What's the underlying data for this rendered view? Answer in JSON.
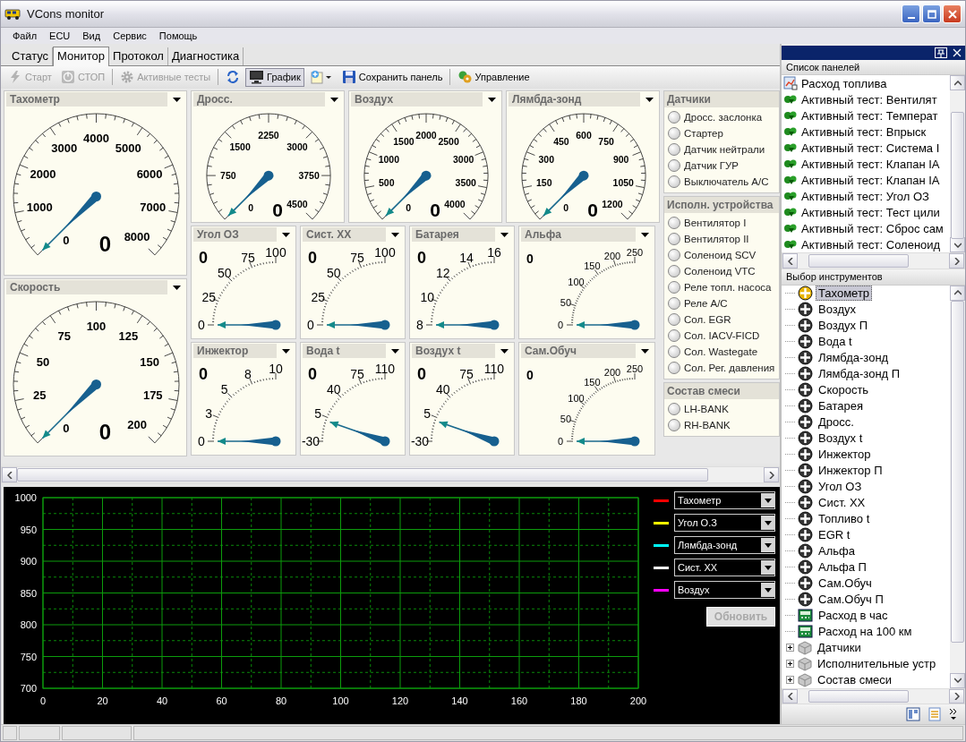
{
  "window": {
    "title": "VCons monitor"
  },
  "menu": [
    "Файл",
    "ECU",
    "Вид",
    "Сервис",
    "Помощь"
  ],
  "tabs": [
    {
      "label": "Статус",
      "selected": false
    },
    {
      "label": "Монитор",
      "selected": true
    },
    {
      "label": "Протокол",
      "selected": false
    },
    {
      "label": "Диагностика",
      "selected": false
    }
  ],
  "toolbar": [
    [
      {
        "kind": "start",
        "label": "Старт",
        "disabled": true,
        "pressed": false
      },
      {
        "kind": "stop",
        "label": "СТОП",
        "disabled": true,
        "pressed": false
      }
    ],
    [
      {
        "kind": "tests",
        "label": "Активные тесты",
        "disabled": true,
        "pressed": false
      }
    ],
    [
      {
        "kind": "refresh",
        "disabled": false,
        "pressed": false
      },
      {
        "kind": "graph",
        "label": "График",
        "disabled": false,
        "pressed": true
      },
      {
        "kind": "add_panel",
        "disabled": false,
        "pressed": false
      },
      {
        "kind": "save",
        "label": "Сохранить панель",
        "disabled": false,
        "pressed": false
      }
    ],
    [
      {
        "kind": "control",
        "label": "Управление",
        "disabled": false,
        "pressed": false
      }
    ]
  ],
  "dashboard": {
    "large": [
      {
        "kind": "round",
        "title": "Тахометр",
        "ticks": [
          "0",
          "1000",
          "2000",
          "3000",
          "4000",
          "5000",
          "6000",
          "7000",
          "8000"
        ],
        "value": "0"
      },
      {
        "kind": "round",
        "title": "Скорость",
        "ticks": [
          "0",
          "25",
          "50",
          "75",
          "100",
          "125",
          "150",
          "175",
          "200"
        ],
        "value": "0"
      }
    ],
    "medium": [
      {
        "kind": "round",
        "title": "Дросс.",
        "ticks": [
          "0",
          "750",
          "1500",
          "2250",
          "3000",
          "3750",
          "4500"
        ],
        "value": "0"
      },
      {
        "kind": "round",
        "title": "Воздух",
        "ticks": [
          "0",
          "500",
          "1000",
          "1500",
          "2000",
          "2500",
          "3000",
          "3500",
          "4000"
        ],
        "value": "0"
      },
      {
        "kind": "round",
        "title": "Лямбда-зонд",
        "ticks": [
          "0",
          "150",
          "300",
          "450",
          "600",
          "750",
          "900",
          "1050",
          "1200"
        ],
        "value": "0"
      }
    ],
    "small_rows": [
      [
        {
          "kind": "quarter",
          "title": "Угол ОЗ",
          "ticks": [
            "0",
            "25",
            "50",
            "75",
            "100"
          ],
          "value": "0"
        },
        {
          "kind": "quarter",
          "title": "Сист. XX",
          "ticks": [
            "0",
            "25",
            "50",
            "75",
            "100"
          ],
          "value": "0"
        },
        {
          "kind": "quarter",
          "title": "Батарея",
          "ticks": [
            "8",
            "10",
            "12",
            "14",
            "16"
          ],
          "value": "0"
        },
        {
          "kind": "quarter",
          "title": "Альфа",
          "ticks": [
            "0",
            "50",
            "100",
            "150",
            "200",
            "250"
          ],
          "value": "0"
        }
      ],
      [
        {
          "kind": "quarter",
          "title": "Инжектор",
          "ticks": [
            "0",
            "3",
            "5",
            "8",
            "10"
          ],
          "value": "0"
        },
        {
          "kind": "quarter",
          "title": "Вода t",
          "ticks": [
            "-30",
            "5",
            "40",
            "75",
            "110"
          ],
          "value": "0"
        },
        {
          "kind": "quarter",
          "title": "Воздух t",
          "ticks": [
            "-30",
            "5",
            "40",
            "75",
            "110"
          ],
          "value": "0"
        },
        {
          "kind": "quarter",
          "title": "Сам.Обуч",
          "ticks": [
            "0",
            "50",
            "100",
            "150",
            "200",
            "250"
          ],
          "value": "0"
        }
      ]
    ]
  },
  "indicator_groups": [
    {
      "title": "Датчики",
      "items": [
        {
          "label": "Дросс. заслонка",
          "on": false
        },
        {
          "label": "Стартер",
          "on": false
        },
        {
          "label": "Датчик нейтрали",
          "on": false
        },
        {
          "label": "Датчик ГУР",
          "on": false
        },
        {
          "label": "Выключатель A/C",
          "on": false
        }
      ]
    },
    {
      "title": "Исполн. устройства",
      "items": [
        {
          "label": "Вентилятор I",
          "on": false
        },
        {
          "label": "Вентилятор II",
          "on": false
        },
        {
          "label": "Соленоид SCV",
          "on": false
        },
        {
          "label": "Соленоид VTC",
          "on": false
        },
        {
          "label": "Реле топл. насоса",
          "on": false
        },
        {
          "label": "Реле A/C",
          "on": false
        },
        {
          "label": "Сол. EGR",
          "on": false
        },
        {
          "label": "Сол. IACV-FICD",
          "on": false
        },
        {
          "label": "Сол. Wastegate",
          "on": false
        },
        {
          "label": "Сол. Рег. давления",
          "on": false
        }
      ]
    },
    {
      "title": "Состав смеси",
      "items": [
        {
          "label": "LH-BANK",
          "on": false
        },
        {
          "label": "RH-BANK",
          "on": false
        }
      ]
    }
  ],
  "graph": {
    "chart_data": {
      "type": "line",
      "grid": true,
      "xlim": [
        0,
        200
      ],
      "ylim": [
        700,
        1000
      ],
      "xticks": [
        0,
        20,
        40,
        60,
        80,
        100,
        120,
        140,
        160,
        180,
        200
      ],
      "yticks": [
        700,
        750,
        800,
        850,
        900,
        950,
        1000
      ],
      "ref_lines": [
        {
          "axis": "x",
          "value": 10
        },
        {
          "axis": "x",
          "value": 30
        },
        {
          "axis": "x",
          "value": 50
        },
        {
          "axis": "x",
          "value": 70
        },
        {
          "axis": "x",
          "value": 90
        },
        {
          "axis": "x",
          "value": 110
        },
        {
          "axis": "x",
          "value": 130
        },
        {
          "axis": "x",
          "value": 150
        },
        {
          "axis": "x",
          "value": 170
        },
        {
          "axis": "x",
          "value": 190
        },
        {
          "axis": "y",
          "value": 725
        },
        {
          "axis": "y",
          "value": 775
        },
        {
          "axis": "y",
          "value": 825
        },
        {
          "axis": "y",
          "value": 875
        },
        {
          "axis": "y",
          "value": 925
        },
        {
          "axis": "y",
          "value": 975
        }
      ]
    },
    "channels": [
      {
        "value": "Тахометр",
        "color": "#ff0000"
      },
      {
        "value": "Угол О.З",
        "color": "#ffff00"
      },
      {
        "value": "Лямбда-зонд",
        "color": "#00ffff"
      },
      {
        "value": "Сист. XX",
        "color": "#ffffff"
      },
      {
        "value": "Воздух",
        "color": "#ff00ff"
      }
    ],
    "refresh_button": {
      "label": "Обновить",
      "disabled": true
    }
  },
  "side_panel": {
    "panel_list": {
      "title": "Список панелей",
      "items": [
        {
          "kind": "panel",
          "label": "Расход топлива"
        },
        {
          "kind": "test",
          "label": "Активный тест: Вентилят"
        },
        {
          "kind": "test",
          "label": "Активный тест: Температ"
        },
        {
          "kind": "test",
          "label": "Активный тест: Впрыск"
        },
        {
          "kind": "test",
          "label": "Активный тест: Система I"
        },
        {
          "kind": "test",
          "label": "Активный тест: Клапан IA"
        },
        {
          "kind": "test",
          "label": "Активный тест: Клапан IA"
        },
        {
          "kind": "test",
          "label": "Активный тест: Угол ОЗ"
        },
        {
          "kind": "test",
          "label": "Активный тест: Тест цили"
        },
        {
          "kind": "test",
          "label": "Активный тест: Сброс сам"
        },
        {
          "kind": "test",
          "label": "Активный тест: Соленоид"
        }
      ]
    },
    "tools": {
      "title": "Выбор инструментов",
      "items": [
        {
          "kind": "gauge",
          "label": "Тахометр",
          "selected": true
        },
        {
          "kind": "gauge",
          "label": "Воздух",
          "selected": false
        },
        {
          "kind": "gauge",
          "label": "Воздух П",
          "selected": false
        },
        {
          "kind": "gauge",
          "label": "Вода t",
          "selected": false
        },
        {
          "kind": "gauge",
          "label": "Лямбда-зонд",
          "selected": false
        },
        {
          "kind": "gauge",
          "label": "Лямбда-зонд П",
          "selected": false
        },
        {
          "kind": "gauge",
          "label": "Скорость",
          "selected": false
        },
        {
          "kind": "gauge",
          "label": "Батарея",
          "selected": false
        },
        {
          "kind": "gauge",
          "label": "Дросс.",
          "selected": false
        },
        {
          "kind": "gauge",
          "label": "Воздух t",
          "selected": false
        },
        {
          "kind": "gauge",
          "label": "Инжектор",
          "selected": false
        },
        {
          "kind": "gauge",
          "label": "Инжектор П",
          "selected": false
        },
        {
          "kind": "gauge",
          "label": "Угол ОЗ",
          "selected": false
        },
        {
          "kind": "gauge",
          "label": "Сист. XX",
          "selected": false
        },
        {
          "kind": "gauge",
          "label": "Топливо t",
          "selected": false
        },
        {
          "kind": "gauge",
          "label": "EGR t",
          "selected": false
        },
        {
          "kind": "gauge",
          "label": "Альфа",
          "selected": false
        },
        {
          "kind": "gauge",
          "label": "Альфа П",
          "selected": false
        },
        {
          "kind": "gauge",
          "label": "Сам.Обуч",
          "selected": false
        },
        {
          "kind": "gauge",
          "label": "Сам.Обуч П",
          "selected": false
        },
        {
          "kind": "counter",
          "label": "Расход в час",
          "selected": false
        },
        {
          "kind": "counter",
          "label": "Расход на 100 км",
          "selected": false
        },
        {
          "kind": "group",
          "label": "Датчики",
          "selected": false,
          "expanded": false
        },
        {
          "kind": "group",
          "label": "Исполнительные устр",
          "selected": false,
          "expanded": false
        },
        {
          "kind": "group",
          "label": "Состав смеси",
          "selected": false,
          "expanded": false
        }
      ]
    }
  }
}
